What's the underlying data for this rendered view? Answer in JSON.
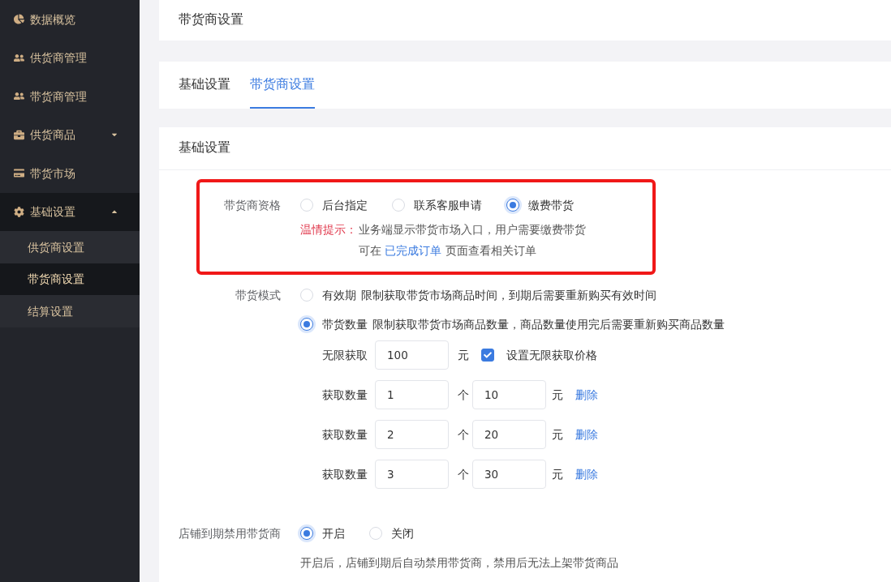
{
  "sidebar": {
    "items": [
      {
        "label": "数据概览",
        "selected": false
      },
      {
        "label": "供货商管理",
        "selected": false
      },
      {
        "label": "带货商管理",
        "selected": false
      },
      {
        "label": "供货商品",
        "selected": false,
        "expanded": false
      },
      {
        "label": "带货市场",
        "selected": false
      },
      {
        "label": "基础设置",
        "selected": false,
        "expanded": true,
        "children": [
          {
            "label": "供货商设置",
            "selected": false
          },
          {
            "label": "带货商设置",
            "selected": true
          },
          {
            "label": "结算设置",
            "selected": false
          }
        ]
      }
    ]
  },
  "header": {
    "title": "带货商设置"
  },
  "tabs": [
    {
      "label": "基础设置",
      "selected": false
    },
    {
      "label": "带货商设置",
      "selected": true
    }
  ],
  "section": {
    "title": "基础设置"
  },
  "form": {
    "qualification": {
      "label": "带货商资格",
      "highlighted": true,
      "options": [
        {
          "label": "后台指定",
          "selected": false
        },
        {
          "label": "联系客服申请",
          "selected": false
        },
        {
          "label": "缴费带货",
          "selected": true
        }
      ],
      "hint": {
        "prefix": "温情提示：",
        "line_1": "业务端显示带货市场入口，用户需要缴费带货",
        "line_2_before": "可在",
        "link": "已完成订单",
        "line_2_after": "页面查看相关订单"
      }
    },
    "mode": {
      "label": "带货模式",
      "options": [
        {
          "label": "有效期",
          "description": "限制获取带货市场商品时间，到期后需要重新购买有效时间",
          "selected": false
        },
        {
          "label": "带货数量",
          "description": "限制获取带货市场商品数量，商品数量使用完后需要重新购买商品数量",
          "selected": true
        }
      ]
    },
    "unlimited": {
      "label": "无限获取",
      "value": "100",
      "unit": "元",
      "checkbox": {
        "label": "设置无限获取价格",
        "checked": true
      }
    },
    "tiers": [
      {
        "label": "获取数量",
        "quantity": "1",
        "quantity_unit": "个",
        "price": "10",
        "price_unit": "元",
        "action": "删除"
      },
      {
        "label": "获取数量",
        "quantity": "2",
        "quantity_unit": "个",
        "price": "20",
        "price_unit": "元",
        "action": "删除"
      },
      {
        "label": "获取数量",
        "quantity": "3",
        "quantity_unit": "个",
        "price": "30",
        "price_unit": "元",
        "action": "删除"
      }
    ],
    "expiry": {
      "label": "店铺到期禁用带货商",
      "options": [
        {
          "label": "开启",
          "selected": true
        },
        {
          "label": "关闭",
          "selected": false
        }
      ],
      "note": "开启后，店铺到期后自动禁用带货商，禁用后无法上架带货商品"
    }
  }
}
